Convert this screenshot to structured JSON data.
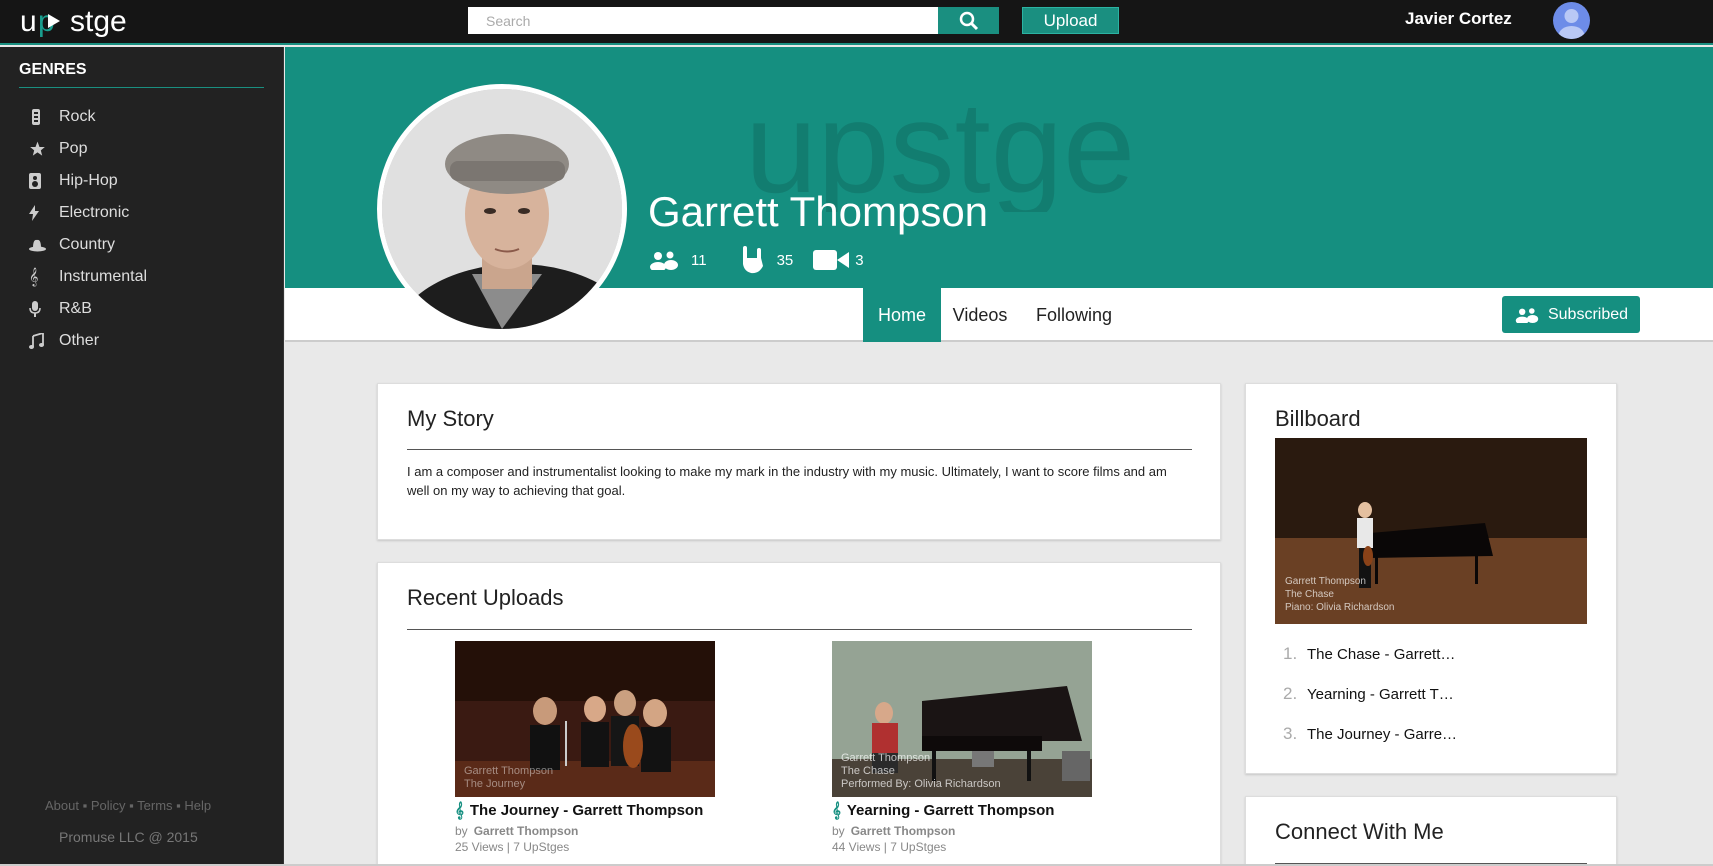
{
  "topbar": {
    "logo_text": "upstge",
    "search_placeholder": "Search",
    "upload_label": "Upload",
    "user_name": "Javier Cortez"
  },
  "sidebar": {
    "title": "GENRES",
    "genres": [
      {
        "label": "Rock",
        "icon": "guitar-icon"
      },
      {
        "label": "Pop",
        "icon": "star-icon"
      },
      {
        "label": "Hip-Hop",
        "icon": "speaker-icon"
      },
      {
        "label": "Electronic",
        "icon": "lightning-icon"
      },
      {
        "label": "Country",
        "icon": "cowboy-hat-icon"
      },
      {
        "label": "Instrumental",
        "icon": "treble-clef-icon"
      },
      {
        "label": "R&B",
        "icon": "microphone-icon"
      },
      {
        "label": "Other",
        "icon": "music-note-icon"
      }
    ],
    "footer_links": [
      "About",
      "Policy",
      "Terms",
      "Help"
    ],
    "copyright": "Promuse LLC @ 2015"
  },
  "profile": {
    "name": "Garrett Thompson",
    "followers": "11",
    "rocks": "35",
    "videos": "3"
  },
  "nav": {
    "tabs": [
      "Home",
      "Videos",
      "Following"
    ],
    "active_tab": "Home",
    "subscribed_label": "Subscribed"
  },
  "story": {
    "title": "My Story",
    "text": "I am a composer and instrumentalist looking to make my mark in the industry with my music. Ultimately, I want to score films and am well on my way to achieving that goal."
  },
  "uploads": {
    "title": "Recent Uploads",
    "items": [
      {
        "title": "The Journey - Garrett Thompson",
        "by": "by",
        "author": "Garrett Thompson",
        "meta": "25 Views | 7 UpStges",
        "caption_line1": "Garrett Thompson",
        "caption_line2": "The Journey",
        "caption_line3": ""
      },
      {
        "title": "Yearning - Garrett Thompson",
        "by": "by",
        "author": "Garrett Thompson",
        "meta": "44 Views | 7 UpStges",
        "caption_line1": "Garrett Thompson",
        "caption_line2": "The Chase",
        "caption_line3": "Performed By: Olivia Richardson"
      }
    ]
  },
  "billboard": {
    "title": "Billboard",
    "caption_line1": "Garrett Thompson",
    "caption_line2": "The Chase",
    "caption_line3": "Piano: Olivia Richardson",
    "items": [
      {
        "num": "1.",
        "label": "The Chase - Garrett…"
      },
      {
        "num": "2.",
        "label": "Yearning - Garrett T…"
      },
      {
        "num": "3.",
        "label": "The Journey - Garre…"
      }
    ]
  },
  "connect": {
    "title": "Connect With Me"
  },
  "colors": {
    "accent": "#158f80",
    "topbar": "#151515",
    "sidebar": "#222222"
  }
}
